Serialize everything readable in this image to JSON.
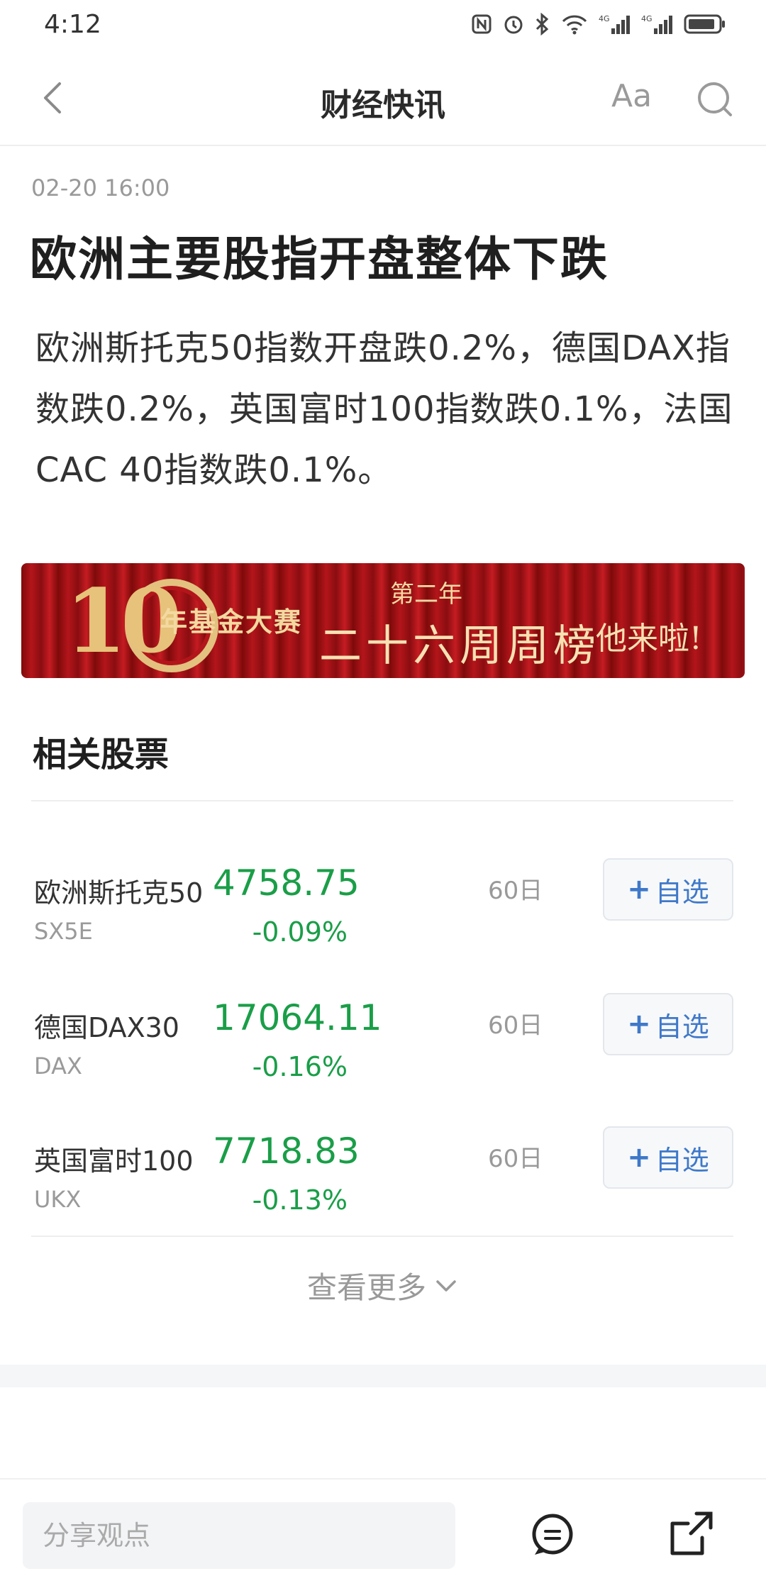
{
  "status_bar": {
    "time": "4:12"
  },
  "nav": {
    "title": "财经快讯",
    "font_label": "Aa"
  },
  "article": {
    "timestamp": "02-20 16:00",
    "headline": "欧洲主要股指开盘整体下跌",
    "body": "欧洲斯托克50指数开盘跌0.2%，德国DAX指数跌0.2%，英国富时100指数跌0.1%，法国CAC 40指数跌0.1%。"
  },
  "banner": {
    "ten": "10",
    "main": "年基金大赛",
    "sub": "第二年",
    "big": "二十六周周榜",
    "tail": "他来啦!"
  },
  "related": {
    "title": "相关股票",
    "stocks": [
      {
        "name": "欧洲斯托克50",
        "code": "SX5E",
        "price": "4758.75",
        "change": "-0.09%",
        "period": "60日",
        "add_label": "自选"
      },
      {
        "name": "德国DAX30",
        "code": "DAX",
        "price": "17064.11",
        "change": "-0.16%",
        "period": "60日",
        "add_label": "自选"
      },
      {
        "name": "英国富时100",
        "code": "UKX",
        "price": "7718.83",
        "change": "-0.13%",
        "period": "60日",
        "add_label": "自选"
      }
    ],
    "more_label": "查看更多"
  },
  "bottom": {
    "share_placeholder": "分享观点"
  },
  "colors": {
    "down_green": "#1a9e48",
    "accent_blue": "#3f78c9",
    "banner_red": "#b3151b"
  },
  "icons": [
    "back-chevron-icon",
    "search-icon",
    "plus-icon",
    "chevron-down-icon",
    "comment-icon",
    "share-icon"
  ]
}
